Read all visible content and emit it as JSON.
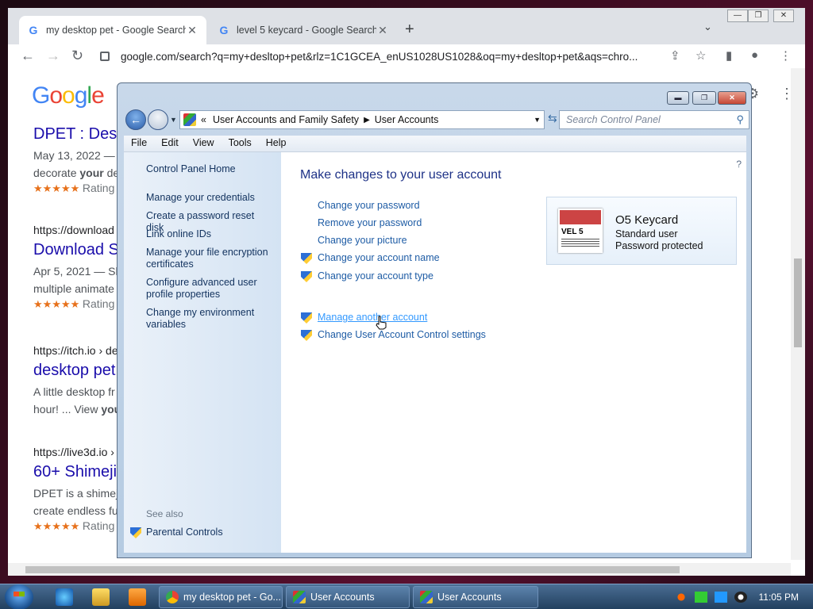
{
  "browser": {
    "tabs": [
      {
        "title": "my desktop pet - Google Search",
        "active": true
      },
      {
        "title": "level 5 keycard - Google Search",
        "active": false
      }
    ],
    "url": "google.com/search?q=my+desltop+pet&rlz=1C1GCEA_enUS1028US1028&oq=my+desltop+pet&aqs=chro...",
    "logo": "Google",
    "results": [
      {
        "title": "DPET : Desk",
        "date": "May 13, 2022 — ",
        "snippet_a": "decorate ",
        "snippet_b": "your",
        "snippet_c": " de",
        "stars": "★★★★★",
        "rating": "Rating"
      },
      {
        "url": "https://download",
        "title": "Download S",
        "date": "Apr 5, 2021 — Sh",
        "snippet": "multiple animate",
        "stars": "★★★★★",
        "rating": "Rating"
      },
      {
        "url": "https://itch.io › de",
        "title": "desktop pet",
        "snippet_a": "A little desktop fr",
        "snippet_b": "hour! ... View ",
        "snippet_c": "you"
      },
      {
        "url": "https://live3d.io ›",
        "title": "60+ Shimeji",
        "snippet_a": "DPET is a shimej",
        "snippet_b": "create endless fu",
        "stars": "★★★★★",
        "rating": "Rating"
      }
    ]
  },
  "ua_window": {
    "breadcrumb": [
      "User Accounts and Family Safety",
      "User Accounts"
    ],
    "breadcrumb_prefix": "«",
    "search_placeholder": "Search Control Panel",
    "menu": [
      "File",
      "Edit",
      "View",
      "Tools",
      "Help"
    ],
    "left_links": {
      "home": "Control Panel Home",
      "credentials": "Manage your credentials",
      "reset_disk": "Create a password reset disk",
      "link_ids": "Link online IDs",
      "encryption": "Manage your file encryption certificates",
      "profile": "Configure advanced user profile properties",
      "env": "Change my environment variables",
      "see_also": "See also",
      "parental": "Parental Controls"
    },
    "heading": "Make changes to your user account",
    "links": {
      "change_password": "Change your password",
      "remove_password": "Remove your password",
      "change_picture": "Change your picture",
      "change_name": "Change your account name",
      "change_type": "Change your account type",
      "manage_other": "Manage another account",
      "uac": "Change User Account Control settings"
    },
    "user": {
      "name": "O5 Keycard",
      "type": "Standard user",
      "protection": "Password protected",
      "avatar_text": "VEL 5"
    }
  },
  "taskbar": {
    "tasks": [
      "my desktop pet - Go...",
      "User Accounts",
      "User Accounts"
    ],
    "clock": "11:05 PM"
  }
}
